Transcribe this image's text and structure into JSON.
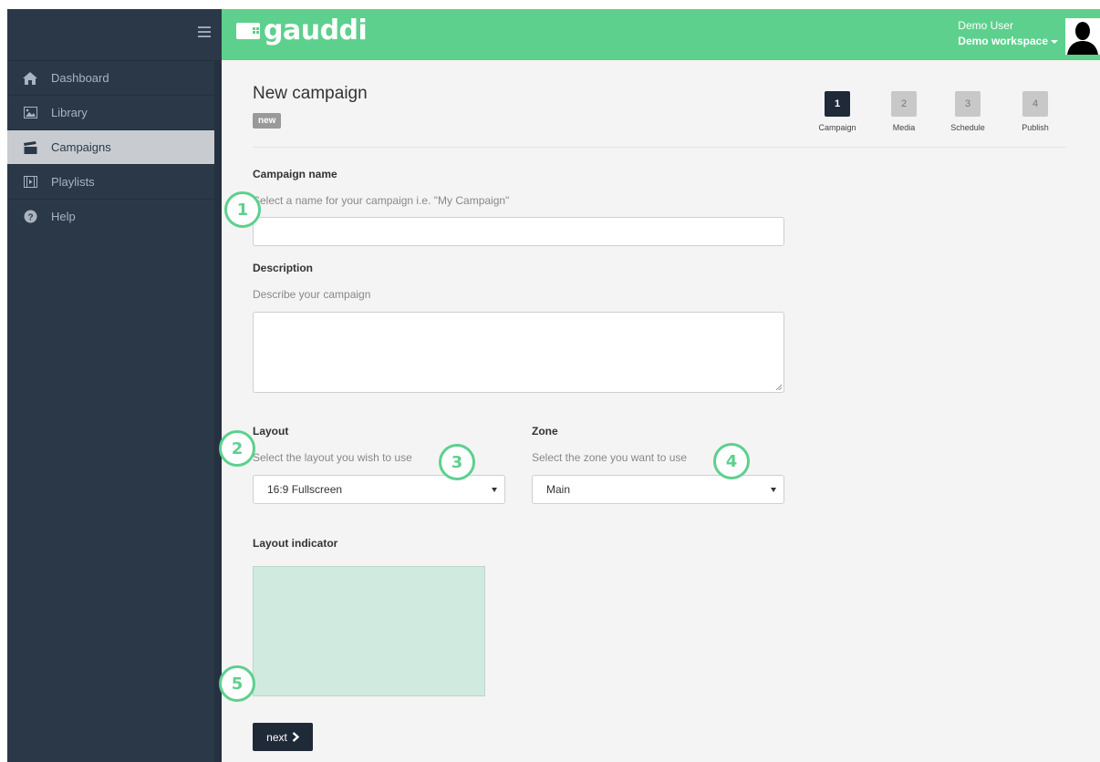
{
  "sidebar": {
    "items": [
      {
        "label": "Dashboard",
        "icon": "home-icon",
        "active": false
      },
      {
        "label": "Library",
        "icon": "image-icon",
        "active": false
      },
      {
        "label": "Campaigns",
        "icon": "clapperboard-icon",
        "active": true
      },
      {
        "label": "Playlists",
        "icon": "film-icon",
        "active": false
      },
      {
        "label": "Help",
        "icon": "question-circle-icon",
        "active": false
      }
    ]
  },
  "header": {
    "logo_text": "gauddi",
    "user_name": "Demo User",
    "workspace": "Demo workspace"
  },
  "page": {
    "title": "New campaign",
    "badge": "new"
  },
  "steps": [
    {
      "number": "1",
      "label": "Campaign",
      "active": true
    },
    {
      "number": "2",
      "label": "Media",
      "active": false
    },
    {
      "number": "3",
      "label": "Schedule",
      "active": false
    },
    {
      "number": "4",
      "label": "Publish",
      "active": false
    }
  ],
  "form": {
    "campaign_name_label": "Campaign name",
    "campaign_name_help": "Select a name for your campaign i.e. \"My Campaign\"",
    "campaign_name_value": "",
    "description_label": "Description",
    "description_help": "Describe your campaign",
    "description_value": "",
    "layout_label": "Layout",
    "layout_help": "Select the layout you wish to use",
    "layout_value": "16:9 Fullscreen",
    "zone_label": "Zone",
    "zone_help": "Select the zone you want to use",
    "zone_value": "Main",
    "layout_indicator_label": "Layout indicator",
    "next_label": "next"
  },
  "markers": [
    "1",
    "2",
    "3",
    "4",
    "5"
  ],
  "colors": {
    "brand_green": "#5dd08e",
    "sidebar_bg": "#2b3847",
    "dark_button": "#1f2a38",
    "indicator_fill": "#d0eadf"
  }
}
